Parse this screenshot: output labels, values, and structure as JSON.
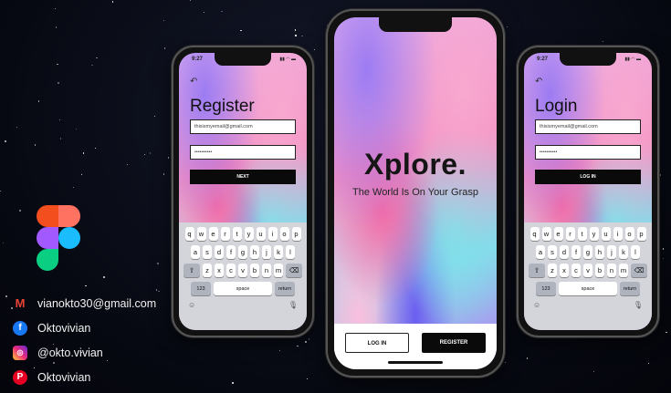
{
  "contacts": [
    {
      "icon": "gmail-icon",
      "text": "vianokto30@gmail.com",
      "color": "#ea4335"
    },
    {
      "icon": "facebook-icon",
      "text": "Oktovivian",
      "color": "#1877f2"
    },
    {
      "icon": "instagram-icon",
      "text": "@okto.vivian",
      "color": "#c13584"
    },
    {
      "icon": "pinterest-icon",
      "text": "Oktovivian",
      "color": "#e60023"
    }
  ],
  "register": {
    "time": "9:27",
    "title": "Register",
    "email": "thisismyemail@gmail.com",
    "password": "••••••••••",
    "button": "NEXT"
  },
  "center": {
    "brand": "Xplore.",
    "tagline": "The World Is On Your Grasp",
    "login_button": "LOG IN",
    "register_button": "REGISTER"
  },
  "login": {
    "time": "9:27",
    "title": "Login",
    "email": "thisismyemail@gmail.com",
    "password": "••••••••••",
    "button": "LOG IN"
  },
  "keyboard": {
    "row1": [
      "q",
      "w",
      "e",
      "r",
      "t",
      "y",
      "u",
      "i",
      "o",
      "p"
    ],
    "row2": [
      "a",
      "s",
      "d",
      "f",
      "g",
      "h",
      "j",
      "k",
      "l"
    ],
    "row3": [
      "z",
      "x",
      "c",
      "v",
      "b",
      "n",
      "m"
    ],
    "num": "123",
    "space": "space",
    "return": "return"
  }
}
